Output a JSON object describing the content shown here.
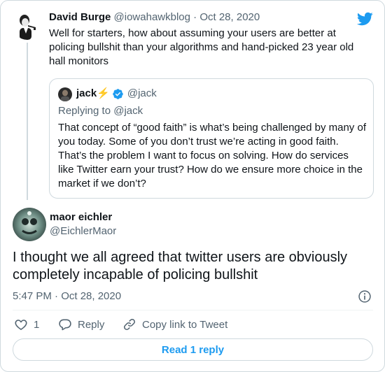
{
  "parent_tweet": {
    "name": "David Burge",
    "handle": "@iowahawkblog",
    "separator": "·",
    "date": "Oct 28, 2020",
    "text": "Well for starters, how about assuming your users are better at policing bullshit than your algorithms and hand-picked 23 year old hall monitors",
    "icon": "twitter-bird-icon"
  },
  "quoted_tweet": {
    "name": "jack⚡️",
    "handle": "@jack",
    "replying_to": "Replying to @jack",
    "text": "That concept of “good faith” is what’s being challenged by many of you today. Some of you don’t trust we’re acting in good faith. That’s the problem I want to focus on solving. How do services like Twitter earn your trust? How do we ensure more choice in the market if we don’t?"
  },
  "main_tweet": {
    "name": "maor eichler",
    "handle": "@EichlerMaor",
    "text": "I thought we all agreed that twitter users are obviously completely incapable of policing bullshit",
    "time": "5:47 PM · Oct 28, 2020"
  },
  "actions": {
    "like_count": "1",
    "reply_label": "Reply",
    "copy_link_label": "Copy link to Tweet"
  },
  "read_replies_label": "Read 1 reply",
  "colors": {
    "brand_blue": "#1d9bf0",
    "text": "#0f1419",
    "muted": "#536471",
    "border": "#cfd9de"
  }
}
